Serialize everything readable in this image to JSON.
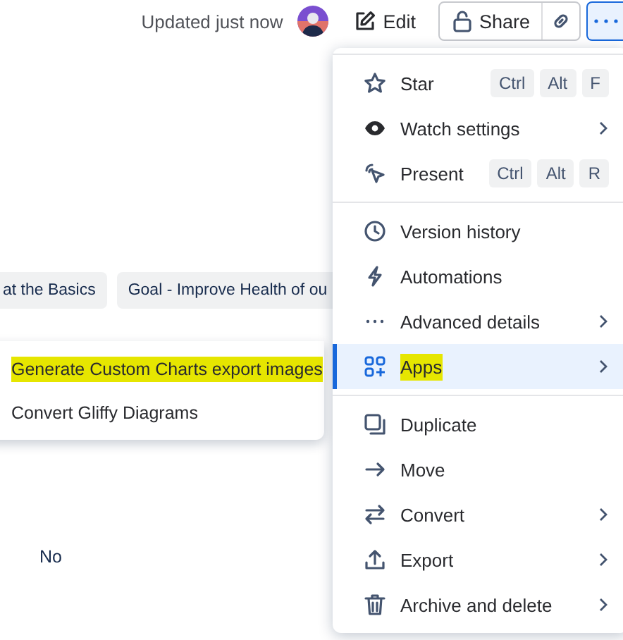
{
  "header": {
    "status": "Updated just now",
    "edit": "Edit",
    "share": "Share"
  },
  "chips": [
    "at the Basics",
    "Goal - Improve Health of ou"
  ],
  "submenu": {
    "items": [
      {
        "label": "Generate Custom Charts export images",
        "highlighted": true
      },
      {
        "label": "Convert Gliffy Diagrams",
        "highlighted": false
      }
    ]
  },
  "cell": "No",
  "menu": {
    "groups": [
      {
        "items": [
          {
            "label": "Star",
            "shortcut": [
              "Ctrl",
              "Alt",
              "F"
            ],
            "has_submenu": false,
            "selected": false,
            "highlighted": false
          },
          {
            "label": "Watch settings",
            "has_submenu": true,
            "selected": false,
            "highlighted": false
          },
          {
            "label": "Present",
            "shortcut": [
              "Ctrl",
              "Alt",
              "R"
            ],
            "has_submenu": false,
            "selected": false,
            "highlighted": false
          }
        ]
      },
      {
        "items": [
          {
            "label": "Version history",
            "has_submenu": false,
            "selected": false,
            "highlighted": false
          },
          {
            "label": "Automations",
            "has_submenu": false,
            "selected": false,
            "highlighted": false
          },
          {
            "label": "Advanced details",
            "has_submenu": true,
            "selected": false,
            "highlighted": false
          },
          {
            "label": "Apps",
            "has_submenu": true,
            "selected": true,
            "highlighted": true
          }
        ]
      },
      {
        "items": [
          {
            "label": "Duplicate",
            "has_submenu": false,
            "selected": false,
            "highlighted": false
          },
          {
            "label": "Move",
            "has_submenu": false,
            "selected": false,
            "highlighted": false
          },
          {
            "label": "Convert",
            "has_submenu": true,
            "selected": false,
            "highlighted": false
          },
          {
            "label": "Export",
            "has_submenu": true,
            "selected": false,
            "highlighted": false
          },
          {
            "label": "Archive and delete",
            "has_submenu": true,
            "selected": false,
            "highlighted": false
          }
        ]
      }
    ]
  }
}
